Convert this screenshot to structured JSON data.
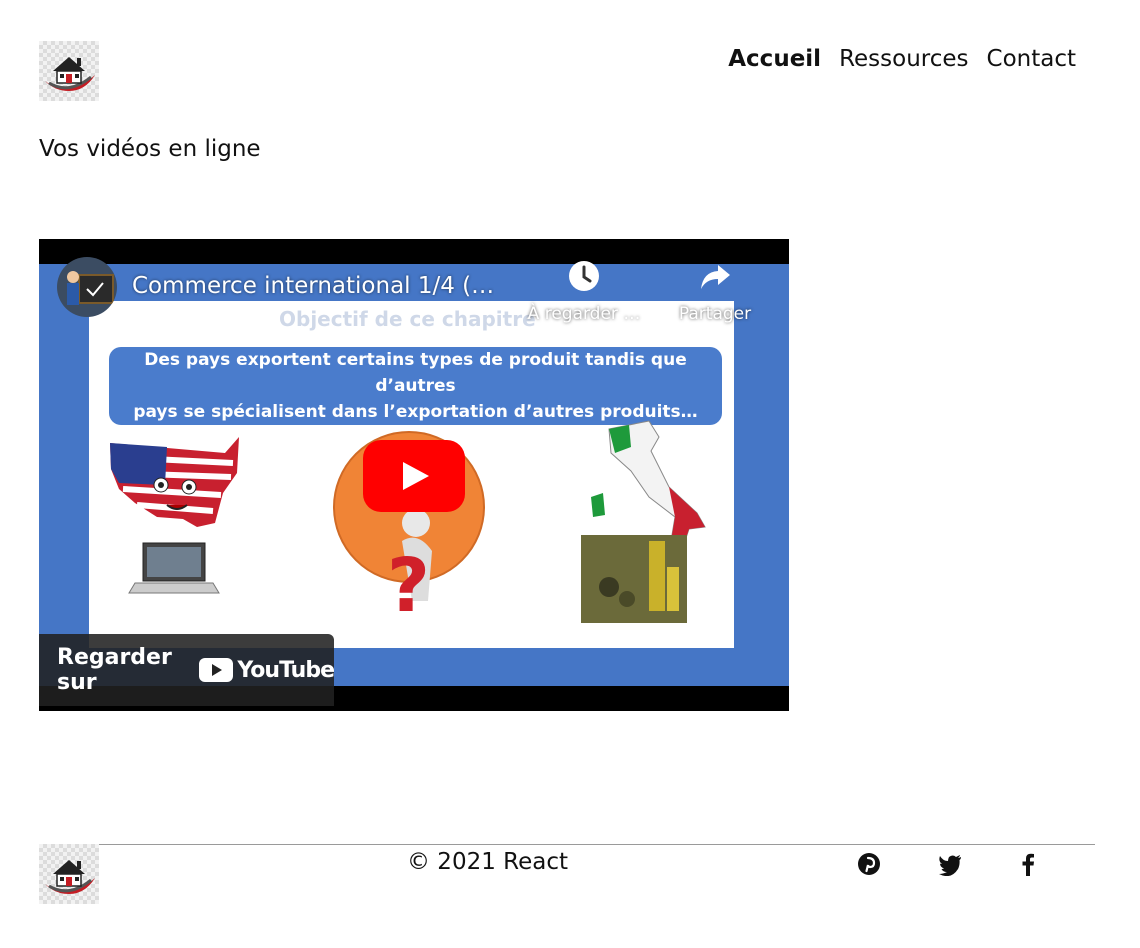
{
  "header": {
    "nav": [
      {
        "label": "Accueil",
        "active": true
      },
      {
        "label": "Ressources",
        "active": false
      },
      {
        "label": "Contact",
        "active": false
      }
    ]
  },
  "main": {
    "title": "Vos vidéos en ligne",
    "video": {
      "title": "Commerce international 1/4 (…",
      "slide_heading": "Objectif de ce chapitre",
      "slide_text_line1": "Des pays exportent certains types de produit tandis que d’autres",
      "slide_text_line2": "pays se spécialisent dans l’exportation d’autres produits…",
      "watch_later_label": "À regarder …",
      "share_label": "Partager",
      "watch_on_label": "Regarder sur",
      "youtube_word": "YouTube",
      "brand_red": "#ff0000"
    }
  },
  "footer": {
    "copyright": "© 2021 React",
    "social_icons": [
      "pinterest-icon",
      "twitter-icon",
      "facebook-icon"
    ]
  }
}
